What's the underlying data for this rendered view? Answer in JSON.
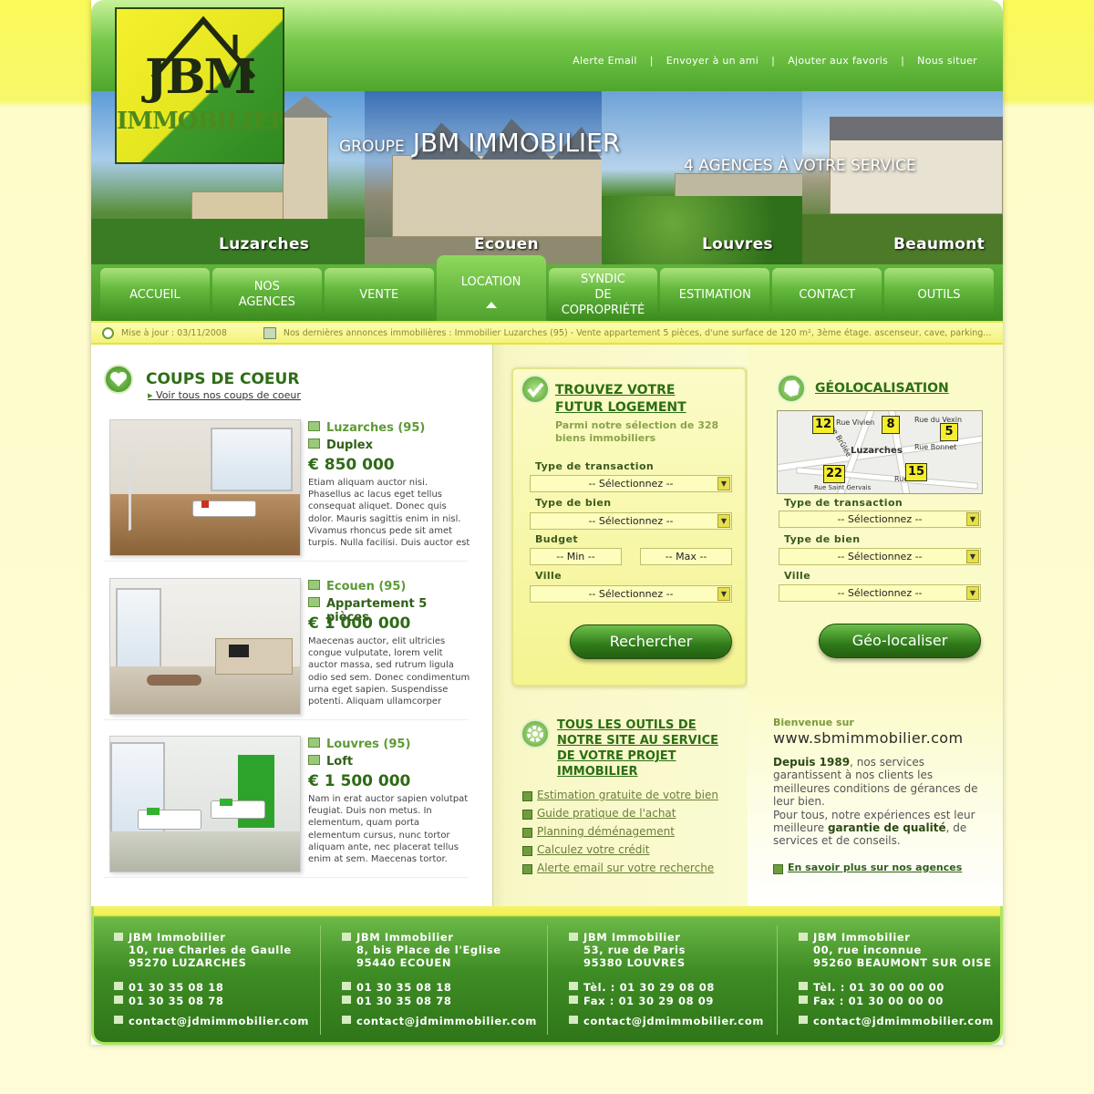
{
  "header": {
    "logo_line1": "JBM",
    "logo_line2": "IMMOBILIER",
    "links": [
      "Alerte Email",
      "Envoyer à un ami",
      "Ajouter aux favoris",
      "Nous situer"
    ],
    "separator": "|"
  },
  "banner": {
    "groupe": "GROUPE",
    "title": "JBM IMMOBILIER",
    "subtitle": "4 AGENCES À VOTRE SERVICE",
    "places": [
      "Luzarches",
      "Ecouen",
      "Louvres",
      "Beaumont"
    ]
  },
  "nav": {
    "items": [
      {
        "label": "ACCUEIL"
      },
      {
        "label": "NOS\nAGENCES"
      },
      {
        "label": "VENTE"
      },
      {
        "label": "LOCATION"
      },
      {
        "label": "SYNDIC\nDE\nCOPROPRIÉTÉ"
      },
      {
        "label": "ESTIMATION"
      },
      {
        "label": "CONTACT"
      },
      {
        "label": "OUTILS"
      }
    ],
    "active": "LOCATION"
  },
  "ticker": {
    "update": "Mise à jour : 03/11/2008",
    "news": "Nos dernières annonces immobilières : Immobilier Luzarches (95) - Vente appartement 5 pièces, d'une surface de 120 m², 3ème étage. ascenseur, cave, parking..."
  },
  "coups_de_coeur": {
    "title": "COUPS DE COEUR",
    "link": "Voir tous nos coups de coeur",
    "cards": [
      {
        "loc": "Luzarches (95)",
        "type": "Duplex",
        "price": "€  850 000",
        "desc": "Etiam aliquam auctor nisi. Phasellus ac lacus eget tellus consequat aliquet. Donec quis dolor. Mauris sagittis enim in nisl. Vivamus rhoncus pede sit amet turpis. Nulla facilisi. Duis auctor est in tortor. In ligula libero, consequat vitae,"
      },
      {
        "loc": "Ecouen (95)",
        "type": "Appartement 5 pièces",
        "price": "€  1 000 000",
        "desc": "Maecenas auctor, elit ultricies congue vulputate, lorem velit auctor massa, sed rutrum ligula odio sed sem. Donec condimentum urna eget sapien. Suspendisse potenti. Aliquam ullamcorper auctor lectus. Proin vel ante sed orci tempus"
      },
      {
        "loc": "Louvres (95)",
        "type": "Loft",
        "price": "€  1 500 000",
        "desc": "Nam in erat auctor sapien volutpat feugiat. Duis non metus. In elementum, quam porta elementum cursus, nunc tortor aliquam ante, nec placerat tellus enim at sem. Maecenas tortor. Maecenas sed massa sit amet orci fringilla gravida."
      }
    ]
  },
  "search": {
    "title_line1": "TROUVEZ VOTRE",
    "title_line2": "FUTUR LOGEMENT",
    "subtitle": "Parmi notre sélection de 328 biens immobiliers",
    "label_transaction": "Type de transaction",
    "label_bien": "Type de bien",
    "label_budget": "Budget",
    "label_ville": "Ville",
    "select_placeholder": "-- Sélectionnez --",
    "min_placeholder": "-- Min --",
    "max_placeholder": "-- Max --",
    "button": "Rechercher"
  },
  "tools": {
    "title": "TOUS LES OUTILS DE NOTRE SITE AU SERVICE DE VOTRE PROJET IMMOBILIER",
    "items": [
      "Estimation gratuite de votre bien",
      "Guide pratique de l'achat",
      "Planning déménagement",
      "Calculez votre crédit",
      "Alerte email sur votre recherche"
    ]
  },
  "geo": {
    "title": "GÉOLOCALISATION",
    "map_markers": [
      "12",
      "8",
      "5",
      "22",
      "15"
    ],
    "map_town": "Luzarches",
    "map_streets": [
      "Rue Vivien",
      "Rue du Vexin",
      "Rue Bonnet",
      "Rue Brûlée",
      "Rue Sa",
      "Rue Saint Gervais"
    ],
    "label_transaction": "Type de transaction",
    "label_bien": "Type de bien",
    "label_ville": "Ville",
    "select_placeholder": "-- Sélectionnez --",
    "button": "Géo-localiser"
  },
  "welcome": {
    "line1": "Bienvenue sur",
    "site": "www.sbmimmobilier.com",
    "since": "Depuis 1989",
    "text1": ", nos services garantissent à nos clients les meilleures conditions de gérances de leur bien.",
    "text2": "Pour tous, notre expériences est leur meilleure ",
    "quality": "garantie de qualité",
    "text3": ", de services et de conseils.",
    "link": "En savoir plus sur nos agences"
  },
  "footer": {
    "agencies": [
      {
        "name": "JBM Immobilier",
        "addr1": "10, rue Charles de Gaulle",
        "addr2": "95270 LUZARCHES",
        "tel": "01 30 35 08 18",
        "fax": "01 30 35 08 78",
        "email": "contact@jdmimmobilier.com"
      },
      {
        "name": "JBM Immobilier",
        "addr1": "8, bis Place de l'Eglise",
        "addr2": "95440 ECOUEN",
        "tel": "01 30 35 08 18",
        "fax": "01 30 35 08 78",
        "email": "contact@jdmimmobilier.com"
      },
      {
        "name": "JBM Immobilier",
        "addr1": "53, rue de Paris",
        "addr2": "95380 LOUVRES",
        "tel": "Tèl. : 01 30 29 08 08",
        "fax": "Fax : 01 30 29 08 09",
        "email": "contact@jdmimmobilier.com"
      },
      {
        "name": "JBM Immobilier",
        "addr1": "00, rue inconnue",
        "addr2": "95260 BEAUMONT SUR OISE",
        "tel": "Tèl. : 01 30 00 00 00",
        "fax": "Fax : 01 30 00 00 00",
        "email": "contact@jdmimmobilier.com"
      }
    ]
  }
}
